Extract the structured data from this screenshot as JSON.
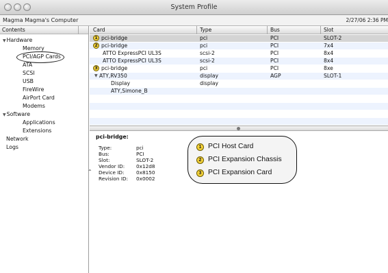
{
  "window": {
    "title": "System Profile",
    "computer_name": "Magma Magma's Computer",
    "timestamp": "2/27/06 2:36 PM"
  },
  "sidebar": {
    "header": "Contents",
    "items": [
      {
        "label": "Hardware",
        "level": 0,
        "expanded": true
      },
      {
        "label": "Memory",
        "level": 1
      },
      {
        "label": "PCI/AGP Cards",
        "level": 1,
        "selected": true
      },
      {
        "label": "ATA",
        "level": 1
      },
      {
        "label": "SCSI",
        "level": 1
      },
      {
        "label": "USB",
        "level": 1
      },
      {
        "label": "FireWire",
        "level": 1
      },
      {
        "label": "AirPort Card",
        "level": 1
      },
      {
        "label": "Modems",
        "level": 1
      },
      {
        "label": "Software",
        "level": 0,
        "expanded": true
      },
      {
        "label": "Applications",
        "level": 1
      },
      {
        "label": "Extensions",
        "level": 1
      },
      {
        "label": "Network",
        "level": 0
      },
      {
        "label": "Logs",
        "level": 0
      }
    ]
  },
  "table": {
    "columns": [
      "Card",
      "Type",
      "Bus",
      "Slot"
    ],
    "rows": [
      {
        "badge": "1",
        "card": "pci-bridge",
        "type": "pci",
        "bus": "PCI",
        "slot": "SLOT-2"
      },
      {
        "badge": "2",
        "card": "pci-bridge",
        "type": "pci",
        "bus": "PCI",
        "slot": "7x4"
      },
      {
        "badge": "",
        "card": "ATTO ExpressPCI UL3S",
        "type": "scsi-2",
        "bus": "PCI",
        "slot": "8x4"
      },
      {
        "badge": "",
        "card": "ATTO ExpressPCI UL3S",
        "type": "scsi-2",
        "bus": "PCI",
        "slot": "8x4"
      },
      {
        "badge": "3",
        "card": "pci-bridge",
        "type": "pci",
        "bus": "PCI",
        "slot": "8xe"
      },
      {
        "badge": "",
        "card": "ATY,RV350",
        "type": "display",
        "bus": "AGP",
        "slot": "SLOT-1"
      },
      {
        "badge": "",
        "card": "Display",
        "type": "display",
        "bus": "",
        "slot": ""
      },
      {
        "badge": "",
        "card": "ATY,Simone_B",
        "type": "",
        "bus": "",
        "slot": ""
      }
    ]
  },
  "detail": {
    "title": "pci-bridge:",
    "fields": [
      {
        "label": "Type:",
        "value": "pci"
      },
      {
        "label": "Bus:",
        "value": "PCI"
      },
      {
        "label": "Slot:",
        "value": "SLOT-2"
      },
      {
        "label": "Vendor ID:",
        "value": "0x12d8"
      },
      {
        "label": "Device ID:",
        "value": "0x8150"
      },
      {
        "label": "Revision ID:",
        "value": "0x0002"
      }
    ]
  },
  "callout": {
    "items": [
      {
        "number": "1",
        "label": "PCI Host Card"
      },
      {
        "number": "2",
        "label": "PCI Expansion Chassis"
      },
      {
        "number": "3",
        "label": "PCI Expansion Card"
      }
    ]
  }
}
